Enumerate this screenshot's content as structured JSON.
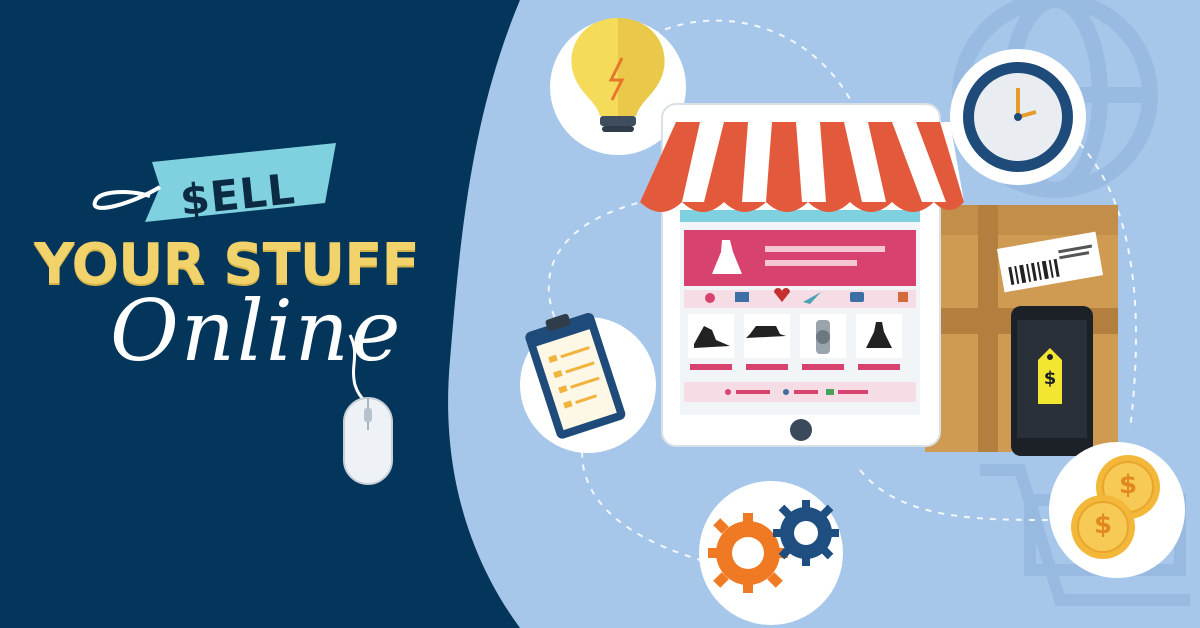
{
  "banner": {
    "tag_text": "$ELL",
    "headline": "YOUR STUFF",
    "script_word": "Online"
  },
  "icons": [
    "lightbulb-icon",
    "clock-icon",
    "clipboard-icon",
    "gears-icon",
    "coins-icon",
    "mouse-icon",
    "storefront-tablet-icon",
    "package-box-icon",
    "smartphone-icon"
  ],
  "phone": {
    "price_symbol": "$"
  },
  "coins": {
    "symbol": "$"
  },
  "colors": {
    "navy": "#04365b",
    "light_blue": "#a7c7ea",
    "tag_cyan": "#7fd1e0",
    "headline_yellow": "#f2d26a",
    "awning_red": "#e25a3b",
    "banner_pink": "#d8426e",
    "box_brown": "#cf9a52",
    "gear_orange": "#f07a24",
    "gear_navy": "#1f4e80"
  }
}
